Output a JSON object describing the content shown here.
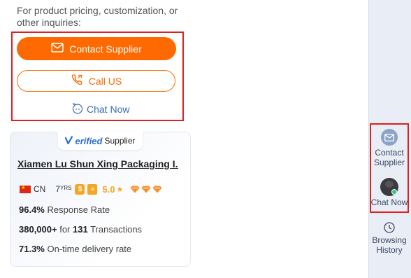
{
  "inquiry": {
    "prompt": "For product pricing, customization, or other inquiries:",
    "contact_label": "Contact Supplier",
    "call_label": "Call US",
    "chat_label": "Chat Now"
  },
  "supplier": {
    "verified_word": "erified",
    "verified_suffix": "Supplier",
    "name": "Xiamen Lu Shun Xing Packaging I...",
    "country": "CN",
    "years_num": "7",
    "years_unit": "YRS",
    "rating": "5.0",
    "response_rate_value": "96.4%",
    "response_rate_label": "Response Rate",
    "transactions_amount": "380,000+",
    "transactions_for": "for",
    "transactions_count": "131",
    "transactions_label": "Transactions",
    "ontime_value": "71.3%",
    "ontime_label": "On-time delivery rate"
  },
  "rail": {
    "contact_label_line1": "Contact",
    "contact_label_line2": "Supplier",
    "chat_label": "Chat Now",
    "history_line1": "Browsing",
    "history_line2": "History"
  },
  "colors": {
    "accent": "#ff6a00",
    "highlight_box": "#e02020",
    "link_blue": "#3a6fb0",
    "rating_gold": "#f5a623"
  }
}
